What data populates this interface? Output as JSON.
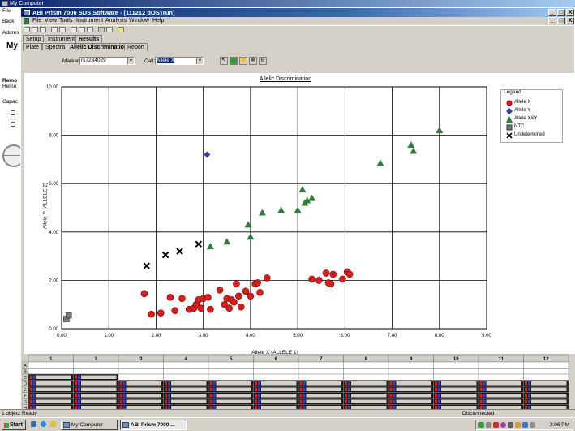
{
  "background_window": {
    "title": "My Computer",
    "sidebar_fragments": [
      "File",
      "Back",
      "Addres",
      "My",
      "Remo",
      "Remo",
      "Capac"
    ]
  },
  "app": {
    "title": "ABI Prism 7000 SDS Software - [111212 pOSTrun]",
    "window_buttons": [
      "_",
      "□",
      "X"
    ],
    "doc_window_buttons": [
      "_",
      "□",
      "X"
    ],
    "menu": [
      "File",
      "View",
      "Tools",
      "Instrument",
      "Analysis",
      "Window",
      "Help"
    ]
  },
  "tabs_top": [
    "Setup",
    "Instrument",
    "Results"
  ],
  "tabs_sub": [
    "Plate",
    "Spectra",
    "Allelic Discrimination",
    "Report"
  ],
  "controls": {
    "marker_label": "Marker:",
    "marker_value": "rs7234029",
    "call_label": "Call:",
    "call_value": "Allele X"
  },
  "legend": {
    "title": "Legend",
    "items": [
      {
        "label": "Allele X",
        "icon": "red-circle",
        "color": "#d42020"
      },
      {
        "label": "Allele Y",
        "icon": "blue-diamond",
        "color": "#3a3aa0"
      },
      {
        "label": "Allele X&Y",
        "icon": "green-triangle",
        "color": "#2e7d3a"
      },
      {
        "label": "NTC",
        "icon": "gray-square",
        "color": "#7a7a7a"
      },
      {
        "label": "Undetermined",
        "icon": "black-x",
        "color": "#000000"
      }
    ]
  },
  "chart_data": {
    "type": "scatter",
    "title": "Allelic Discrimination",
    "xlabel": "Allele X (ALLELE 1)",
    "ylabel": "Allele Y (ALLELE 2)",
    "xlim": [
      0,
      9
    ],
    "ylim": [
      0,
      10
    ],
    "x_ticks": [
      "0.00",
      "1.00",
      "2.00",
      "3.00",
      "4.00",
      "5.00",
      "6.00",
      "7.00",
      "8.00",
      "9.00"
    ],
    "y_ticks": [
      "0.00",
      "2.00",
      "4.00",
      "6.00",
      "8.00",
      "10.00"
    ],
    "grid": true,
    "series": [
      {
        "name": "Allele X",
        "marker": "circle",
        "color": "#d42020",
        "points": [
          [
            1.75,
            1.45
          ],
          [
            1.9,
            0.6
          ],
          [
            2.1,
            0.65
          ],
          [
            2.3,
            1.3
          ],
          [
            2.4,
            0.75
          ],
          [
            2.55,
            1.25
          ],
          [
            2.7,
            0.8
          ],
          [
            2.8,
            0.85
          ],
          [
            2.85,
            1.0
          ],
          [
            2.9,
            1.2
          ],
          [
            2.95,
            0.85
          ],
          [
            3.0,
            1.25
          ],
          [
            3.1,
            1.3
          ],
          [
            3.15,
            0.8
          ],
          [
            3.35,
            1.6
          ],
          [
            3.45,
            1.0
          ],
          [
            3.5,
            1.25
          ],
          [
            3.55,
            0.85
          ],
          [
            3.6,
            1.2
          ],
          [
            3.65,
            1.1
          ],
          [
            3.7,
            1.85
          ],
          [
            3.75,
            1.35
          ],
          [
            3.8,
            0.9
          ],
          [
            3.9,
            1.55
          ],
          [
            4.0,
            1.35
          ],
          [
            4.1,
            1.85
          ],
          [
            4.15,
            1.9
          ],
          [
            4.2,
            1.5
          ],
          [
            4.35,
            2.1
          ],
          [
            5.3,
            2.05
          ],
          [
            5.45,
            2.0
          ],
          [
            5.6,
            2.3
          ],
          [
            5.65,
            1.9
          ],
          [
            5.7,
            1.85
          ],
          [
            5.75,
            2.25
          ],
          [
            5.95,
            2.05
          ],
          [
            6.05,
            2.35
          ],
          [
            6.1,
            2.25
          ]
        ]
      },
      {
        "name": "Allele Y",
        "marker": "diamond",
        "color": "#3a3aa0",
        "points": [
          [
            3.08,
            7.2
          ]
        ]
      },
      {
        "name": "Allele X&Y",
        "marker": "triangle",
        "color": "#2e7d3a",
        "points": [
          [
            3.15,
            3.4
          ],
          [
            3.5,
            3.6
          ],
          [
            3.95,
            4.3
          ],
          [
            4.0,
            3.8
          ],
          [
            4.25,
            4.8
          ],
          [
            4.65,
            4.9
          ],
          [
            5.0,
            4.9
          ],
          [
            5.15,
            5.2
          ],
          [
            5.2,
            5.3
          ],
          [
            5.3,
            5.4
          ],
          [
            5.1,
            5.75
          ],
          [
            6.75,
            6.85
          ],
          [
            7.4,
            7.6
          ],
          [
            7.45,
            7.35
          ],
          [
            8.0,
            8.2
          ]
        ]
      },
      {
        "name": "NTC",
        "marker": "square",
        "color": "#7a7a7a",
        "points": [
          [
            0.1,
            0.4
          ],
          [
            0.15,
            0.55
          ]
        ]
      },
      {
        "name": "Undetermined",
        "marker": "x",
        "color": "#000000",
        "points": [
          [
            1.8,
            2.6
          ],
          [
            2.2,
            3.05
          ],
          [
            2.5,
            3.2
          ],
          [
            2.9,
            3.5
          ]
        ]
      }
    ]
  },
  "plate": {
    "columns": [
      "1",
      "2",
      "3",
      "4",
      "5",
      "6",
      "7",
      "8",
      "9",
      "10",
      "11",
      "12"
    ],
    "rows": [
      "A",
      "B",
      "C",
      "D",
      "E",
      "F",
      "G",
      "H"
    ]
  },
  "status": {
    "left": "1 object",
    "ready": "Ready",
    "connection": "Disconnected"
  },
  "taskbar": {
    "start": "Start",
    "tasks": [
      "My Computer",
      "ABI Prism 7000 ..."
    ],
    "clock": "2:06 PM"
  }
}
